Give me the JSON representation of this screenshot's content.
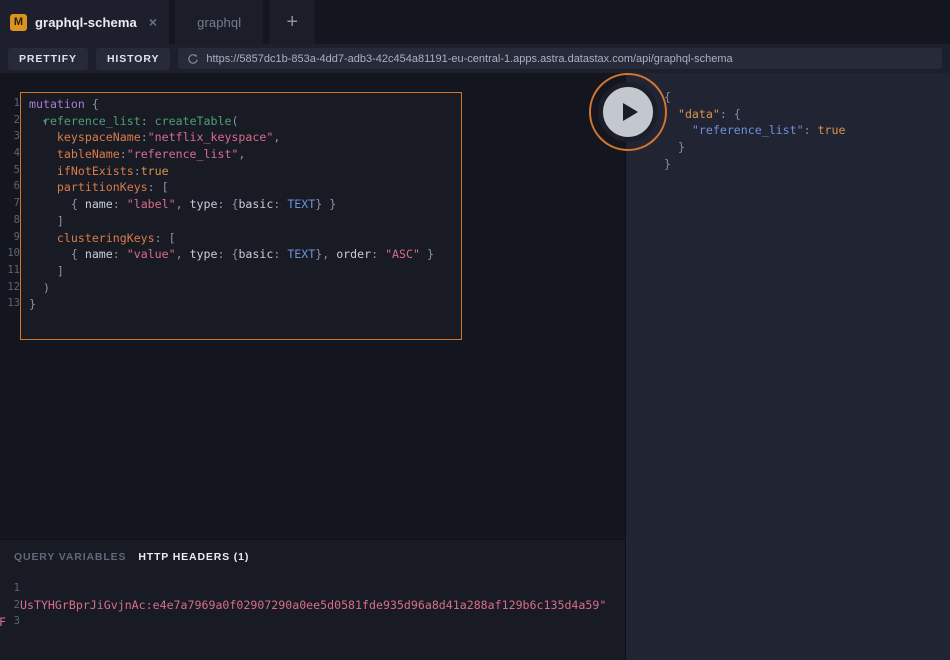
{
  "tabs": {
    "active": {
      "badge": "M",
      "label": "graphql-schema",
      "close": "×"
    },
    "inactive": {
      "label": "graphql"
    },
    "add": "+"
  },
  "toolbar": {
    "prettify_label": "PRETTIFY",
    "history_label": "HISTORY",
    "url": "https://5857dc1b-853a-4dd7-adb3-42c454a81191-eu-central-1.apps.astra.datastax.com/api/graphql-schema",
    "reload_icon": "reload-icon"
  },
  "play": {
    "icon": "play-icon"
  },
  "editor": {
    "line_numbers": [
      "1",
      "2",
      "3",
      "4",
      "5",
      "6",
      "7",
      "8",
      "9",
      "10",
      "11",
      "12",
      "13"
    ],
    "fold_arrow": "▾",
    "lines": [
      [
        {
          "t": "mutation",
          "c": "t-kw"
        },
        {
          "t": " ",
          "c": "t-pun"
        },
        {
          "t": "{",
          "c": "t-pun"
        }
      ],
      [
        {
          "t": "  ",
          "c": "t-pun"
        },
        {
          "t": "reference_list",
          "c": "t-fld"
        },
        {
          "t": ": ",
          "c": "t-pun"
        },
        {
          "t": "createTable",
          "c": "t-fld"
        },
        {
          "t": "(",
          "c": "t-pun"
        }
      ],
      [
        {
          "t": "    ",
          "c": "t-pun"
        },
        {
          "t": "keyspaceName",
          "c": "t-arg"
        },
        {
          "t": ":",
          "c": "t-pun"
        },
        {
          "t": "\"netflix_keyspace\"",
          "c": "t-str"
        },
        {
          "t": ",",
          "c": "t-pun"
        }
      ],
      [
        {
          "t": "    ",
          "c": "t-pun"
        },
        {
          "t": "tableName",
          "c": "t-arg"
        },
        {
          "t": ":",
          "c": "t-pun"
        },
        {
          "t": "\"reference_list\"",
          "c": "t-str"
        },
        {
          "t": ",",
          "c": "t-pun"
        }
      ],
      [
        {
          "t": "    ",
          "c": "t-pun"
        },
        {
          "t": "ifNotExists",
          "c": "t-arg"
        },
        {
          "t": ":",
          "c": "t-pun"
        },
        {
          "t": "true",
          "c": "t-bool"
        }
      ],
      [
        {
          "t": "    ",
          "c": "t-pun"
        },
        {
          "t": "partitionKeys",
          "c": "t-arg"
        },
        {
          "t": ": [",
          "c": "t-pun"
        }
      ],
      [
        {
          "t": "      { ",
          "c": "t-pun"
        },
        {
          "t": "name",
          "c": "t-obj"
        },
        {
          "t": ": ",
          "c": "t-pun"
        },
        {
          "t": "\"label\"",
          "c": "t-str"
        },
        {
          "t": ", ",
          "c": "t-pun"
        },
        {
          "t": "type",
          "c": "t-obj"
        },
        {
          "t": ": {",
          "c": "t-pun"
        },
        {
          "t": "basic",
          "c": "t-obj"
        },
        {
          "t": ": ",
          "c": "t-pun"
        },
        {
          "t": "TEXT",
          "c": "t-enum"
        },
        {
          "t": "} }",
          "c": "t-pun"
        }
      ],
      [
        {
          "t": "    ]",
          "c": "t-pun"
        }
      ],
      [
        {
          "t": "    ",
          "c": "t-pun"
        },
        {
          "t": "clusteringKeys",
          "c": "t-arg"
        },
        {
          "t": ": [",
          "c": "t-pun"
        }
      ],
      [
        {
          "t": "      { ",
          "c": "t-pun"
        },
        {
          "t": "name",
          "c": "t-obj"
        },
        {
          "t": ": ",
          "c": "t-pun"
        },
        {
          "t": "\"value\"",
          "c": "t-str"
        },
        {
          "t": ", ",
          "c": "t-pun"
        },
        {
          "t": "type",
          "c": "t-obj"
        },
        {
          "t": ": {",
          "c": "t-pun"
        },
        {
          "t": "basic",
          "c": "t-obj"
        },
        {
          "t": ": ",
          "c": "t-pun"
        },
        {
          "t": "TEXT",
          "c": "t-enum"
        },
        {
          "t": "}, ",
          "c": "t-pun"
        },
        {
          "t": "order",
          "c": "t-obj"
        },
        {
          "t": ": ",
          "c": "t-pun"
        },
        {
          "t": "\"ASC\"",
          "c": "t-str"
        },
        {
          "t": " }",
          "c": "t-pun"
        }
      ],
      [
        {
          "t": "    ]",
          "c": "t-pun"
        }
      ],
      [
        {
          "t": "  )",
          "c": "t-pun"
        }
      ],
      [
        {
          "t": "}",
          "c": "t-pun"
        }
      ]
    ]
  },
  "response": {
    "lines": [
      [
        {
          "t": "{",
          "c": "j-pun"
        }
      ],
      [
        {
          "t": "  ",
          "c": "j-pun"
        },
        {
          "t": "\"data\"",
          "c": "j-key"
        },
        {
          "t": ": {",
          "c": "j-pun"
        }
      ],
      [
        {
          "t": "    ",
          "c": "j-pun"
        },
        {
          "t": "\"reference_list\"",
          "c": "j-key2"
        },
        {
          "t": ": ",
          "c": "j-pun"
        },
        {
          "t": "true",
          "c": "j-val"
        }
      ],
      [
        {
          "t": "  }",
          "c": "j-pun"
        }
      ],
      [
        {
          "t": "}",
          "c": "j-pun"
        }
      ]
    ]
  },
  "variables": {
    "tab_query_variables": "QUERY VARIABLES",
    "tab_http_headers": "HTTP HEADERS (1)",
    "line_numbers": [
      "1",
      "2",
      "3"
    ],
    "edge_char": "F",
    "lines": [
      [],
      [
        {
          "t": "UsTYHGrBprJiGvjnAc:e4e7a7969a0f02907290a0ee5d0581fde935d96a8d41a288af129b6c135d4a59\"",
          "c": "v-str"
        }
      ],
      []
    ]
  }
}
